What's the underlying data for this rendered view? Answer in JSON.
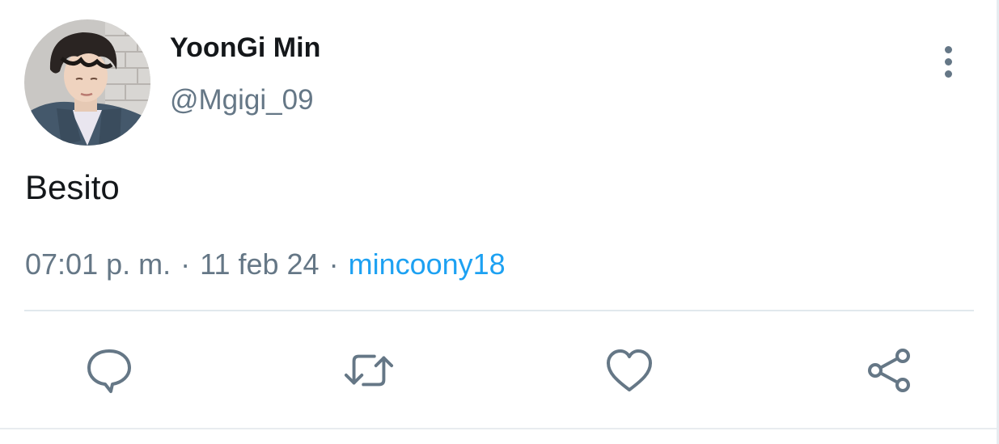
{
  "author": {
    "display_name": "YoonGi Min",
    "handle": "@Mgigi_09",
    "avatar_icon": "profile-photo"
  },
  "tweet": {
    "text": "Besito",
    "time": "07:01 p. m.",
    "separator": "·",
    "date": "11 feb 24",
    "source": "mincoony18"
  },
  "actions": {
    "reply_icon": "speech-bubble-icon",
    "retweet_icon": "retweet-arrows-icon",
    "like_icon": "heart-outline-icon",
    "share_icon": "share-nodes-icon"
  },
  "colors": {
    "text_primary": "#14171a",
    "text_secondary": "#657786",
    "accent": "#1da1f2",
    "divider": "#e1e8ed"
  }
}
